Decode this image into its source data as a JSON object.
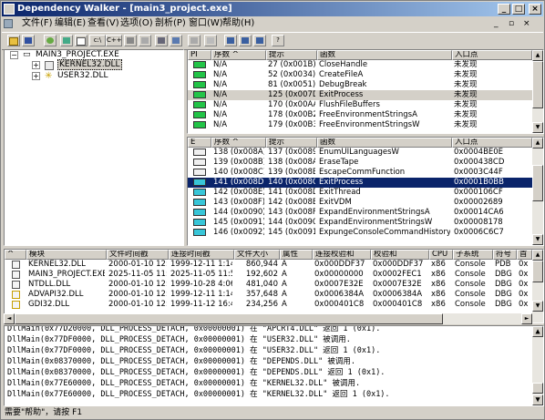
{
  "title": "Dependency Walker - [main3_project.exe]",
  "menu": [
    "文件(F)",
    "编辑(E)",
    "查看(V)",
    "选项(O)",
    "剖析(P)",
    "窗口(W)",
    "帮助(H)"
  ],
  "tree": {
    "root": "MAIN3_PROJECT.EXE",
    "children": [
      "KERNEL32.DLL",
      "USER32.DLL"
    ]
  },
  "parent_imports": {
    "headers": [
      "PI",
      "序数 ^",
      "提示",
      "函数",
      "入口点"
    ],
    "rows": [
      {
        "ordinal": "N/A",
        "hint": "27 (0x001B)",
        "function": "CloseHandle",
        "entry": "未发现"
      },
      {
        "ordinal": "N/A",
        "hint": "52 (0x0034)",
        "function": "CreateFileA",
        "entry": "未发现"
      },
      {
        "ordinal": "N/A",
        "hint": "81 (0x0051)",
        "function": "DebugBreak",
        "entry": "未发现"
      },
      {
        "ordinal": "N/A",
        "hint": "125 (0x007D)",
        "function": "ExitProcess",
        "entry": "未发现",
        "highlight": true
      },
      {
        "ordinal": "N/A",
        "hint": "170 (0x00AA)",
        "function": "FlushFileBuffers",
        "entry": "未发现"
      },
      {
        "ordinal": "N/A",
        "hint": "178 (0x00B2)",
        "function": "FreeEnvironmentStringsA",
        "entry": "未发现"
      },
      {
        "ordinal": "N/A",
        "hint": "179 (0x00B3)",
        "function": "FreeEnvironmentStringsW",
        "entry": "未发现"
      }
    ]
  },
  "exports": {
    "headers": [
      "E",
      "序数 ^",
      "提示",
      "函数",
      "入口点"
    ],
    "rows": [
      {
        "ordinal": "138 (0x008A)",
        "hint": "137 (0x0089)",
        "function": "EnumUILanguagesW",
        "entry": "0x0004BE0E"
      },
      {
        "ordinal": "139 (0x008B)",
        "hint": "138 (0x008A)",
        "function": "EraseTape",
        "entry": "0x000438CD"
      },
      {
        "ordinal": "140 (0x008C)",
        "hint": "139 (0x008B)",
        "function": "EscapeCommFunction",
        "entry": "0x0003C44F"
      },
      {
        "ordinal": "141 (0x008D)",
        "hint": "140 (0x008C)",
        "function": "ExitProcess",
        "entry": "0x0001B0BB",
        "selected": true
      },
      {
        "ordinal": "142 (0x008E)",
        "hint": "141 (0x008D)",
        "function": "ExitThread",
        "entry": "0x000106CF"
      },
      {
        "ordinal": "143 (0x008F)",
        "hint": "142 (0x008E)",
        "function": "ExitVDM",
        "entry": "0x00002689"
      },
      {
        "ordinal": "144 (0x0090)",
        "hint": "143 (0x008F)",
        "function": "ExpandEnvironmentStringsA",
        "entry": "0x00014CA6"
      },
      {
        "ordinal": "145 (0x0091)",
        "hint": "144 (0x0090)",
        "function": "ExpandEnvironmentStringsW",
        "entry": "0x00008178"
      },
      {
        "ordinal": "146 (0x0092)",
        "hint": "145 (0x0091)",
        "function": "ExpungeConsoleCommandHistoryA",
        "entry": "0x0006C6C7"
      }
    ]
  },
  "modules": {
    "headers": [
      "^",
      "模块",
      "文件时间戳",
      "连接时间戳",
      "文件大小",
      "属性",
      "连接校验和",
      "校验和",
      "CPU",
      "子系统",
      "符号",
      "首"
    ],
    "rows": [
      [
        "KERNEL32.DLL",
        "2000-01-10 12:00",
        "1999-12-11 1:14",
        "860,944",
        "A",
        "0x000DDF37",
        "0x000DDF37",
        "x86",
        "Console",
        "PDB",
        "0x"
      ],
      [
        "MAIN3_PROJECT.EXE",
        "2025-11-05 11:55",
        "2025-11-05 11:55",
        "192,602",
        "A",
        "0x00000000",
        "0x0002FEC1",
        "x86",
        "Console",
        "DBG",
        "0x"
      ],
      [
        "NTDLL.DLL",
        "2000-01-10 12:00",
        "1999-10-28 4:06",
        "481,040",
        "A",
        "0x0007E32E",
        "0x0007E32E",
        "x86",
        "Console",
        "DBG",
        "0x"
      ],
      [
        "ADVAPI32.DLL",
        "2000-01-10 12:00",
        "1999-12-11 1:14",
        "357,648",
        "A",
        "0x0006384A",
        "0x0006384A",
        "x86",
        "Console",
        "DBG",
        "0x"
      ],
      [
        "GDI32.DLL",
        "2000-01-10 12:00",
        "1999-11-12 16:44",
        "234,256",
        "A",
        "0x000401C8",
        "0x000401C8",
        "x86",
        "Console",
        "DBG",
        "0x"
      ]
    ]
  },
  "log": [
    "DllMain(0x77D20000, DLL_PROCESS_DETACH, 0x00000001) 在 \"APCRT4.DLL\" 返回 1 (0x1).",
    "DllMain(0x77DF0000, DLL_PROCESS_DETACH, 0x00000001) 在 \"USER32.DLL\" 被调用.",
    "DllMain(0x77DF0000, DLL_PROCESS_DETACH, 0x00000001) 在 \"USER32.DLL\" 返回 1 (0x1).",
    "DllMain(0x08370000, DLL_PROCESS_DETACH, 0x00000001) 在 \"DEPENDS.DLL\" 被调用.",
    "DllMain(0x08370000, DLL_PROCESS_DETACH, 0x00000001) 在 \"DEPENDS.DLL\" 返回 1 (0x1).",
    "DllMain(0x77E60000, DLL_PROCESS_DETACH, 0x00000001) 在 \"KERNEL32.DLL\" 被调用.",
    "DllMain(0x77E60000, DLL_PROCESS_DETACH, 0x00000001) 在 \"KERNEL32.DLL\" 返回 1 (0x1)."
  ],
  "status": "需要\"帮助\"，请按 F1",
  "colors": {
    "title_start": "#0a246a",
    "title_end": "#a6caf0",
    "selection": "#0a246a",
    "face": "#d4d0c8",
    "icon_green": "#22c447",
    "icon_cyan": "#38c6d8"
  }
}
